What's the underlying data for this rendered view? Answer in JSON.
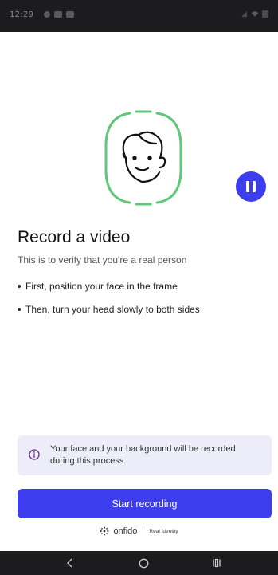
{
  "status_bar": {
    "time": "12:29"
  },
  "main": {
    "title": "Record a video",
    "subtitle": "This is to verify that you're a real person",
    "steps": [
      "First, position your face in the frame",
      "Then, turn your head slowly to both sides"
    ],
    "info_text": "Your face and your background will be recorded during this process",
    "start_button_label": "Start recording"
  },
  "branding": {
    "name": "onfido",
    "tagline": "Real Identity"
  },
  "colors": {
    "accent": "#3c3ded",
    "frame_green": "#5cc878",
    "info_bg": "#ededfa",
    "info_icon": "#6b2f8f"
  },
  "icons": {
    "pause": "pause-icon",
    "info": "info-icon",
    "face": "face-illustration",
    "back": "back-icon",
    "home": "home-icon",
    "recents": "recents-icon"
  }
}
